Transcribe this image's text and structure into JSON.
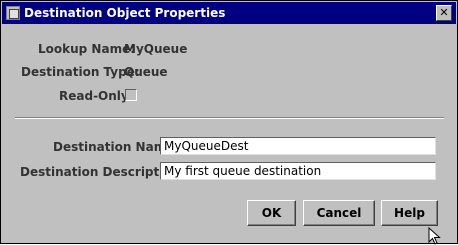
{
  "window": {
    "title": "Destination Object Properties",
    "close_glyph": "✕"
  },
  "info": {
    "lookup_name_label": "Lookup Name:",
    "lookup_name_value": "MyQueue",
    "destination_type_label": "Destination Type:",
    "destination_type_value": "Queue",
    "read_only_label": "Read-Only:",
    "read_only_checked": false
  },
  "form": {
    "destination_name_label": "Destination Name:",
    "destination_name_value": "MyQueueDest",
    "destination_description_label": "Destination Description:",
    "destination_description_value": "My first queue destination"
  },
  "buttons": {
    "ok": "OK",
    "cancel": "Cancel",
    "help": "Help"
  },
  "icons": {
    "app": "window-icon",
    "close": "close-icon",
    "cursor": "mouse-pointer-icon"
  }
}
